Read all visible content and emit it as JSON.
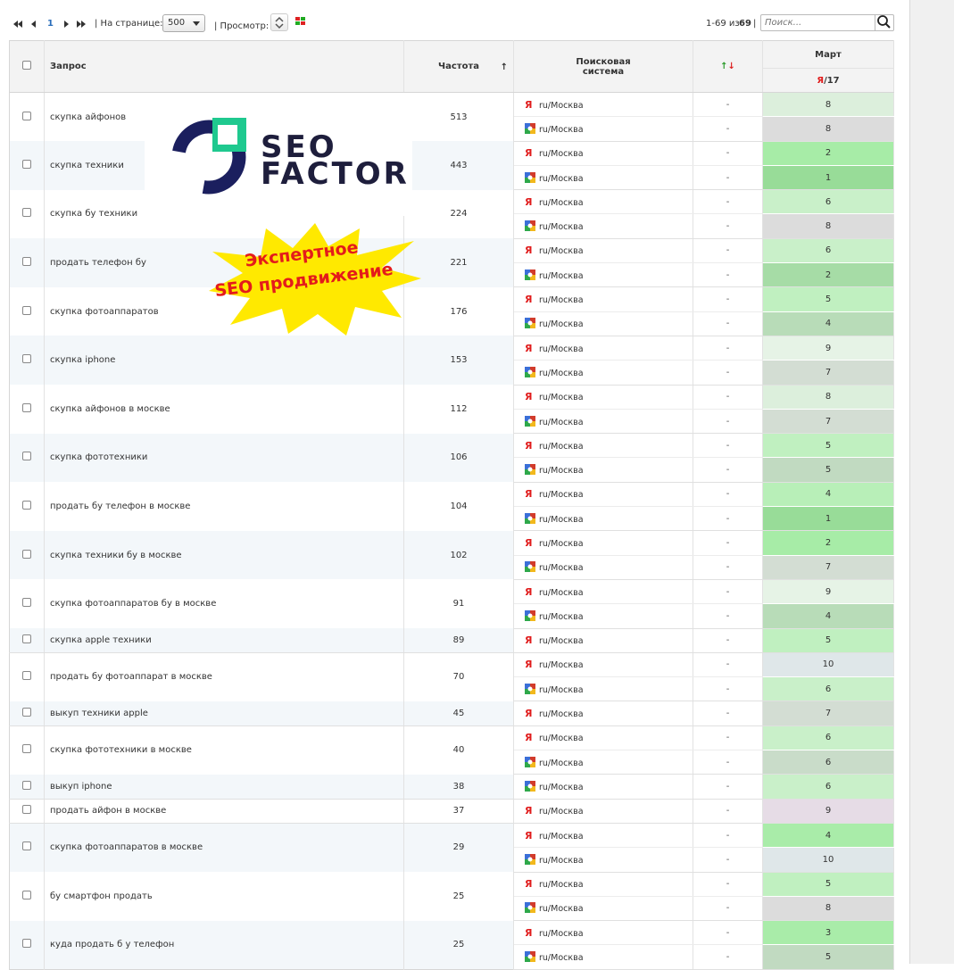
{
  "toolbar": {
    "page_current": "1",
    "per_page_label": "| На странице:",
    "per_page_value": "500",
    "view_label": "| Просмотр:",
    "range_text": "1-69 из",
    "range_total": "69",
    "range_sep": "|",
    "search_placeholder": "Поиск..."
  },
  "columns": {
    "query": "Запрос",
    "frequency": "Частота",
    "sort_arrow": "↑",
    "engine": "Поисковая система",
    "delta_up": "↑",
    "delta_down": "↓",
    "month": "Март",
    "engine_short": "Я",
    "day": "/17"
  },
  "rows": [
    {
      "query": "скупка айфонов",
      "freq": "513",
      "positions": [
        {
          "engine": "yandex",
          "region": "ru/Москва",
          "delta": "-",
          "value": "8",
          "color": "#dcefdc"
        },
        {
          "engine": "google",
          "region": "ru/Москва",
          "delta": "-",
          "value": "8",
          "color": "#dcdcdc"
        }
      ]
    },
    {
      "query": "скупка техники",
      "freq": "443",
      "positions": [
        {
          "engine": "yandex",
          "region": "ru/Москва",
          "delta": "-",
          "value": "2",
          "color": "#a7eca7"
        },
        {
          "engine": "google",
          "region": "ru/Москва",
          "delta": "-",
          "value": "1",
          "color": "#98dc98"
        }
      ]
    },
    {
      "query": "скупка бу техники",
      "freq": "224",
      "positions": [
        {
          "engine": "yandex",
          "region": "ru/Москва",
          "delta": "-",
          "value": "6",
          "color": "#c9f0c9"
        },
        {
          "engine": "google",
          "region": "ru/Москва",
          "delta": "-",
          "value": "8",
          "color": "#dcdcdc"
        }
      ]
    },
    {
      "query": "продать телефон бу",
      "freq": "221",
      "positions": [
        {
          "engine": "yandex",
          "region": "ru/Москва",
          "delta": "-",
          "value": "6",
          "color": "#c9f0c9"
        },
        {
          "engine": "google",
          "region": "ru/Москва",
          "delta": "-",
          "value": "2",
          "color": "#a6dca6"
        }
      ]
    },
    {
      "query": "скупка фотоаппаратов",
      "freq": "176",
      "positions": [
        {
          "engine": "yandex",
          "region": "ru/Москва",
          "delta": "-",
          "value": "5",
          "color": "#c0f0c0"
        },
        {
          "engine": "google",
          "region": "ru/Москва",
          "delta": "-",
          "value": "4",
          "color": "#b8dcb8"
        }
      ]
    },
    {
      "query": "скупка iphone",
      "freq": "153",
      "positions": [
        {
          "engine": "yandex",
          "region": "ru/Москва",
          "delta": "-",
          "value": "9",
          "color": "#e6f3e6"
        },
        {
          "engine": "google",
          "region": "ru/Москва",
          "delta": "-",
          "value": "7",
          "color": "#d3ddd3"
        }
      ]
    },
    {
      "query": "скупка айфонов в москве",
      "freq": "112",
      "positions": [
        {
          "engine": "yandex",
          "region": "ru/Москва",
          "delta": "-",
          "value": "8",
          "color": "#dcefdc"
        },
        {
          "engine": "google",
          "region": "ru/Москва",
          "delta": "-",
          "value": "7",
          "color": "#d3ddd3"
        }
      ]
    },
    {
      "query": "скупка фототехники",
      "freq": "106",
      "positions": [
        {
          "engine": "yandex",
          "region": "ru/Москва",
          "delta": "-",
          "value": "5",
          "color": "#c0f0c0"
        },
        {
          "engine": "google",
          "region": "ru/Москва",
          "delta": "-",
          "value": "5",
          "color": "#c1dac1"
        }
      ]
    },
    {
      "query": "продать бу телефон в москве",
      "freq": "104",
      "positions": [
        {
          "engine": "yandex",
          "region": "ru/Москва",
          "delta": "-",
          "value": "4",
          "color": "#b8efb8"
        },
        {
          "engine": "google",
          "region": "ru/Москва",
          "delta": "-",
          "value": "1",
          "color": "#98dc98"
        }
      ]
    },
    {
      "query": "скупка техники бу в москве",
      "freq": "102",
      "positions": [
        {
          "engine": "yandex",
          "region": "ru/Москва",
          "delta": "-",
          "value": "2",
          "color": "#a7eca7"
        },
        {
          "engine": "google",
          "region": "ru/Москва",
          "delta": "-",
          "value": "7",
          "color": "#d3ddd3"
        }
      ]
    },
    {
      "query": "скупка фотоаппаратов бу в москве",
      "freq": "91",
      "positions": [
        {
          "engine": "yandex",
          "region": "ru/Москва",
          "delta": "-",
          "value": "9",
          "color": "#e6f3e6"
        },
        {
          "engine": "google",
          "region": "ru/Москва",
          "delta": "-",
          "value": "4",
          "color": "#b8dcb8"
        }
      ]
    },
    {
      "query": "скупка apple техники",
      "freq": "89",
      "positions": [
        {
          "engine": "yandex",
          "region": "ru/Москва",
          "delta": "-",
          "value": "5",
          "color": "#c0f0c0"
        }
      ]
    },
    {
      "query": "продать бу фотоаппарат в москве",
      "freq": "70",
      "positions": [
        {
          "engine": "yandex",
          "region": "ru/Москва",
          "delta": "-",
          "value": "10",
          "color": "#dfe7e9"
        },
        {
          "engine": "google",
          "region": "ru/Москва",
          "delta": "-",
          "value": "6",
          "color": "#c9f0c9"
        }
      ]
    },
    {
      "query": "выкуп техники apple",
      "freq": "45",
      "positions": [
        {
          "engine": "yandex",
          "region": "ru/Москва",
          "delta": "-",
          "value": "7",
          "color": "#d3ddd3"
        }
      ]
    },
    {
      "query": "скупка фототехники в москве",
      "freq": "40",
      "positions": [
        {
          "engine": "yandex",
          "region": "ru/Москва",
          "delta": "-",
          "value": "6",
          "color": "#c9f0c9"
        },
        {
          "engine": "google",
          "region": "ru/Москва",
          "delta": "-",
          "value": "6",
          "color": "#c9dcc9"
        }
      ]
    },
    {
      "query": "выкуп iphone",
      "freq": "38",
      "positions": [
        {
          "engine": "google",
          "region": "ru/Москва",
          "delta": "-",
          "value": "6",
          "color": "#c9f0c9"
        }
      ]
    },
    {
      "query": "продать айфон в москве",
      "freq": "37",
      "positions": [
        {
          "engine": "yandex",
          "region": "ru/Москва",
          "delta": "-",
          "value": "9",
          "color": "#e6dce6"
        }
      ]
    },
    {
      "query": "скупка фотоаппаратов в москве",
      "freq": "29",
      "positions": [
        {
          "engine": "yandex",
          "region": "ru/Москва",
          "delta": "-",
          "value": "4",
          "color": "#a9eca9"
        },
        {
          "engine": "google",
          "region": "ru/Москва",
          "delta": "-",
          "value": "10",
          "color": "#dfe7e9"
        }
      ]
    },
    {
      "query": "бу смартфон продать",
      "freq": "25",
      "positions": [
        {
          "engine": "yandex",
          "region": "ru/Москва",
          "delta": "-",
          "value": "5",
          "color": "#c0f0c0"
        },
        {
          "engine": "google",
          "region": "ru/Москва",
          "delta": "-",
          "value": "8",
          "color": "#dcdcdc"
        }
      ]
    },
    {
      "query": "куда продать б у телефон",
      "freq": "25",
      "positions": [
        {
          "engine": "yandex",
          "region": "ru/Москва",
          "delta": "-",
          "value": "3",
          "color": "#a9eca9"
        },
        {
          "engine": "google",
          "region": "ru/Москва",
          "delta": "-",
          "value": "5",
          "color": "#c1dac1"
        }
      ]
    }
  ],
  "overlay": {
    "logo_line1": "SEO",
    "logo_line2": "FACTOR",
    "logo_ring_color": "#1b1f5e",
    "logo_accent_color": "#1fc98f",
    "promo_line1": "Экспертное",
    "promo_line2": "SEO продвижение",
    "promo_burst_color": "#ffe900",
    "promo_text_color": "#e41b1b"
  }
}
